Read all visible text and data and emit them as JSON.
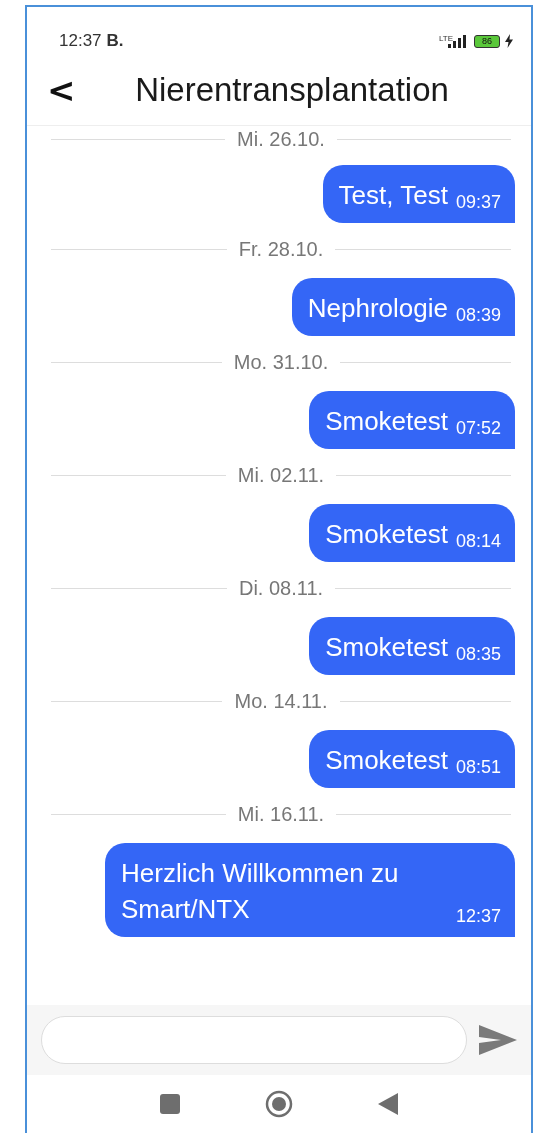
{
  "status_bar": {
    "time": "12:37",
    "carrier": "B.",
    "network": "LTE",
    "battery": "86"
  },
  "header": {
    "back": "<",
    "title": "Nierentransplantation"
  },
  "messages": [
    {
      "kind": "date",
      "text": "Mi. 26.10."
    },
    {
      "kind": "message",
      "text": "Test, Test",
      "time": "09:37"
    },
    {
      "kind": "date",
      "text": "Fr. 28.10."
    },
    {
      "kind": "message",
      "text": "Nephrologie",
      "time": "08:39"
    },
    {
      "kind": "date",
      "text": "Mo. 31.10."
    },
    {
      "kind": "message",
      "text": "Smoketest",
      "time": "07:52"
    },
    {
      "kind": "date",
      "text": "Mi. 02.11."
    },
    {
      "kind": "message",
      "text": "Smoketest",
      "time": "08:14"
    },
    {
      "kind": "date",
      "text": "Di. 08.11."
    },
    {
      "kind": "message",
      "text": "Smoketest",
      "time": "08:35"
    },
    {
      "kind": "date",
      "text": "Mo. 14.11."
    },
    {
      "kind": "message",
      "text": "Smoketest",
      "time": "08:51"
    },
    {
      "kind": "date",
      "text": "Mi. 16.11."
    },
    {
      "kind": "message",
      "text": "Herzlich Willkommen zu Smart/NTX",
      "time": "12:37"
    }
  ]
}
